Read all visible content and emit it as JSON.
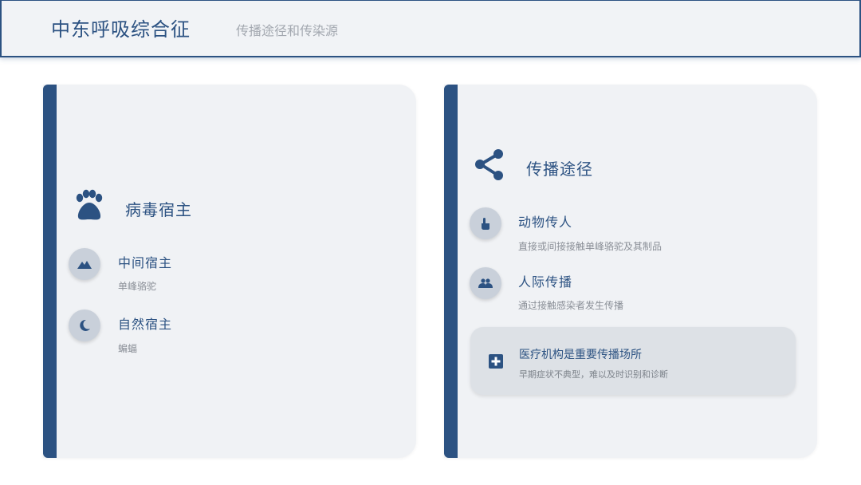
{
  "header": {
    "title": "中东呼吸综合征",
    "subtitle": "传播途径和传染源"
  },
  "hosts": {
    "title": "病毒宿主",
    "icon": "paw-icon",
    "items": [
      {
        "title": "中间宿主",
        "desc": "单峰骆驼",
        "icon": "mountain-icon"
      },
      {
        "title": "自然宿主",
        "desc": "蝙蝠",
        "icon": "moon-icon"
      }
    ]
  },
  "routes": {
    "title": "传播途径",
    "icon": "share-icon",
    "items": [
      {
        "title": "动物传人",
        "desc": "直接或间接接触单峰骆驼及其制品",
        "icon": "hand-pointer-icon"
      },
      {
        "title": "人际传播",
        "desc": "通过接触感染者发生传播",
        "icon": "people-icon"
      }
    ],
    "note": {
      "title": "医疗机构是重要传播场所",
      "desc": "早期症状不典型，难以及时识别和诊断",
      "icon": "medical-cross-icon"
    }
  },
  "colors": {
    "accent": "#2c5282",
    "card_bg": "#f0f2f5",
    "circle_bg": "#c9d0da",
    "muted_text": "#8a8f97"
  }
}
